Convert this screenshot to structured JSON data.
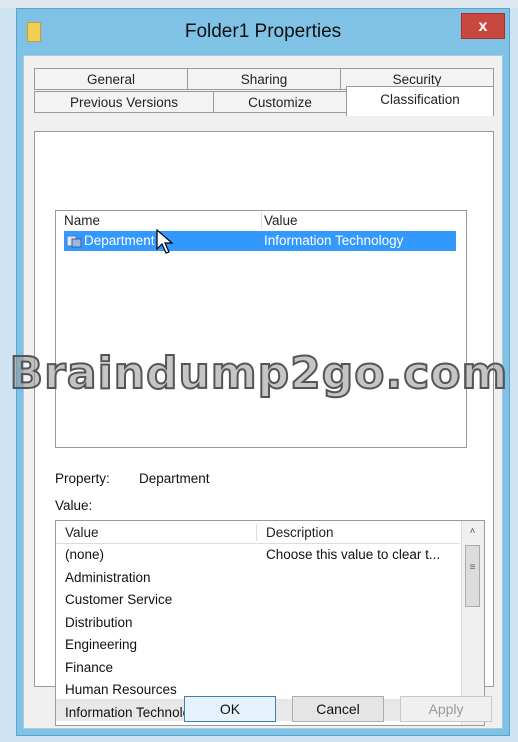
{
  "window": {
    "title": "Folder1 Properties",
    "close_label": "x"
  },
  "tabs_row1": [
    "General",
    "Sharing",
    "Security"
  ],
  "tabs_row2": [
    "Previous Versions",
    "Customize",
    "Classification"
  ],
  "classification_list": {
    "headers": {
      "name": "Name",
      "value": "Value"
    },
    "rows": [
      {
        "name": "Department",
        "value": "Information Technology",
        "selected": true
      }
    ]
  },
  "property_label": "Property:",
  "property_value": "Department",
  "value_label": "Value:",
  "value_list": {
    "headers": {
      "value": "Value",
      "description": "Description"
    },
    "items": [
      "(none)",
      "Administration",
      "Customer Service",
      "Distribution",
      "Engineering",
      "Finance",
      "Human Resources",
      "Information Technology"
    ],
    "none_description": "Choose this value to clear t..."
  },
  "watermark": "Braindump2go.com",
  "buttons": {
    "ok": "OK",
    "cancel": "Cancel",
    "apply": "Apply"
  },
  "colors": {
    "selection": "#3399ff",
    "title_bar": "#7fc2e6",
    "close": "#c8483f"
  }
}
